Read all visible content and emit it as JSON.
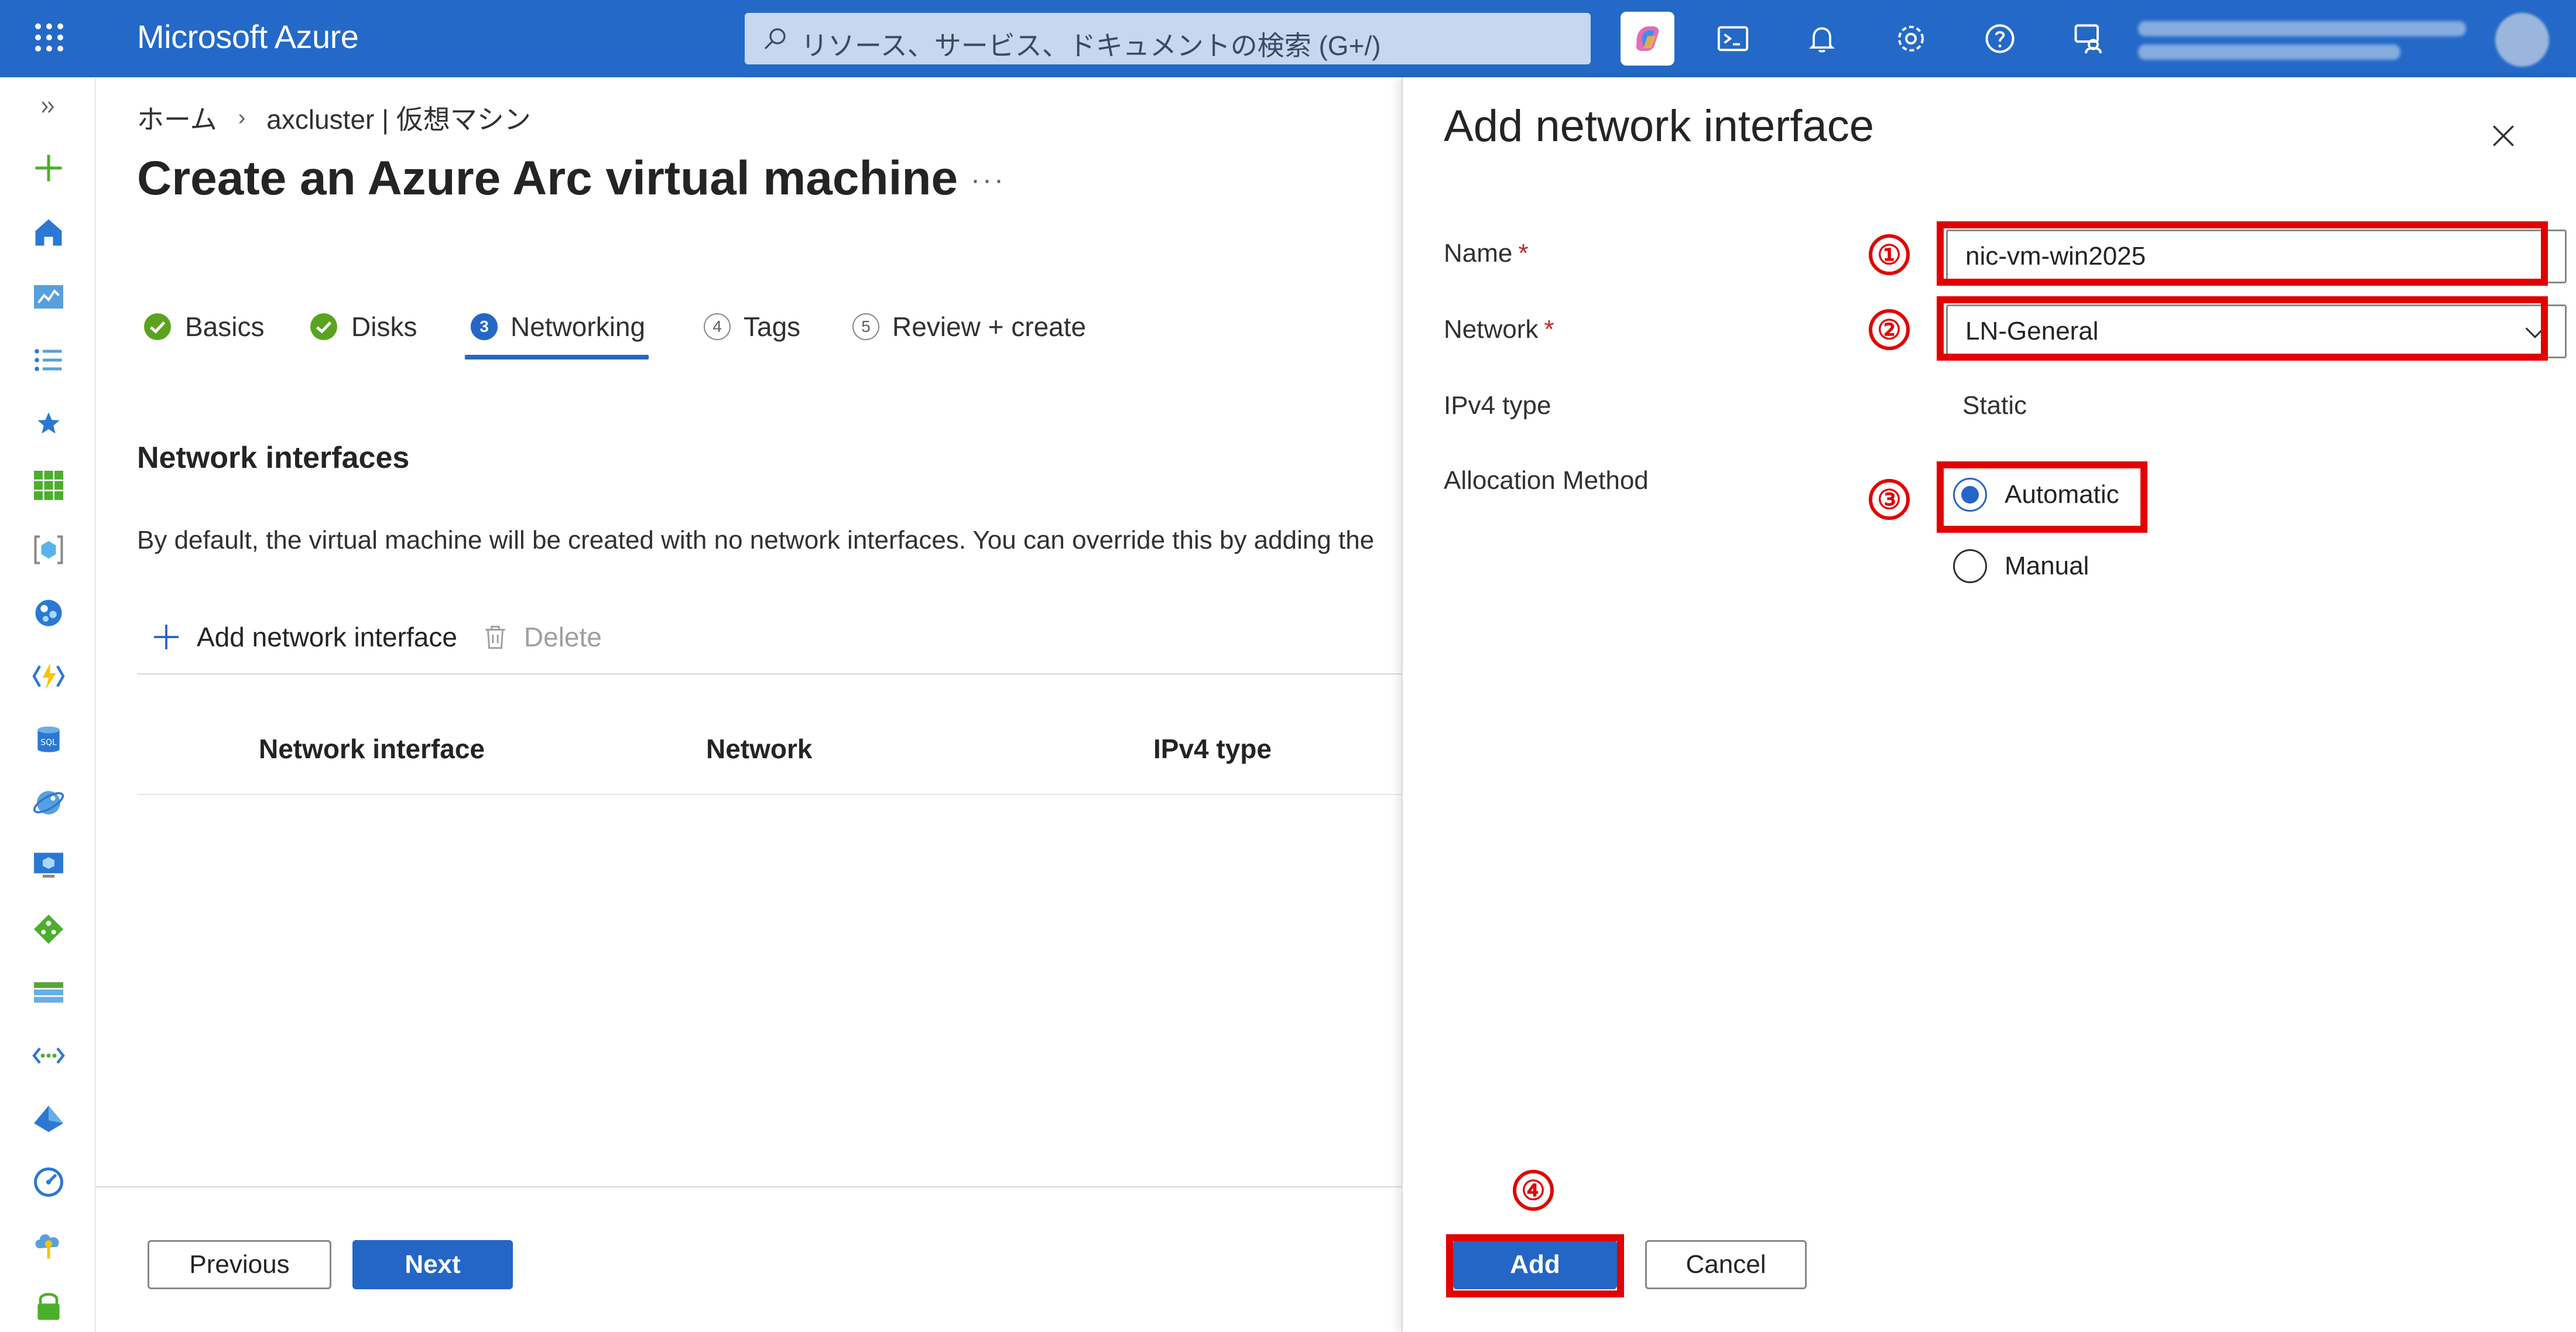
{
  "topbar": {
    "brand": "Microsoft Azure",
    "search_placeholder": "リソース、サービス、ドキュメントの検索 (G+/)",
    "icons": [
      "waffle-menu-icon",
      "copilot-icon",
      "cloud-shell-icon",
      "notifications-icon",
      "settings-icon",
      "help-icon",
      "feedback-icon"
    ],
    "accent_color": "#2469c7"
  },
  "rail": {
    "icons": [
      "expand-icon",
      "create-resource-icon",
      "home-icon",
      "dashboard-icon",
      "all-services-icon",
      "favorites-icon",
      "all-resources-icon",
      "resource-groups-icon",
      "app-services-icon",
      "function-app-icon",
      "sql-databases-icon",
      "cosmos-db-icon",
      "virtual-machines-icon",
      "load-balancers-icon",
      "storage-accounts-icon",
      "virtual-networks-icon",
      "entra-id-icon",
      "monitor-icon",
      "advisor-icon",
      "security-icon"
    ]
  },
  "breadcrumb": {
    "home": "ホーム",
    "current": "axcluster | 仮想マシン"
  },
  "page": {
    "title": "Create an Azure Arc virtual machine",
    "more": "···"
  },
  "tabs": [
    {
      "label": "Basics",
      "state": "complete"
    },
    {
      "label": "Disks",
      "state": "complete"
    },
    {
      "num": "3",
      "label": "Networking",
      "state": "active"
    },
    {
      "num": "4",
      "label": "Tags",
      "state": "pending"
    },
    {
      "num": "5",
      "label": "Review + create",
      "state": "pending"
    }
  ],
  "networking": {
    "section_title": "Network interfaces",
    "description": "By default, the virtual machine will be created with no network interfaces. You can override this by adding the",
    "add_label": "Add network interface",
    "delete_label": "Delete",
    "columns": [
      "Network interface",
      "Network",
      "IPv4 type"
    ]
  },
  "footer": {
    "previous": "Previous",
    "next": "Next"
  },
  "panel": {
    "title": "Add network interface",
    "name_label": "Name",
    "name_value": "nic-vm-win2025",
    "network_label": "Network",
    "network_value": "LN-General",
    "ipv4_label": "IPv4 type",
    "ipv4_value": "Static",
    "allocation_label": "Allocation Method",
    "allocation_options": [
      "Automatic",
      "Manual"
    ],
    "allocation_selected": "Automatic",
    "required_mark": "*",
    "add": "Add",
    "cancel": "Cancel"
  },
  "annotations": {
    "steps": [
      "①",
      "②",
      "③",
      "④"
    ],
    "color": "#e20000"
  }
}
